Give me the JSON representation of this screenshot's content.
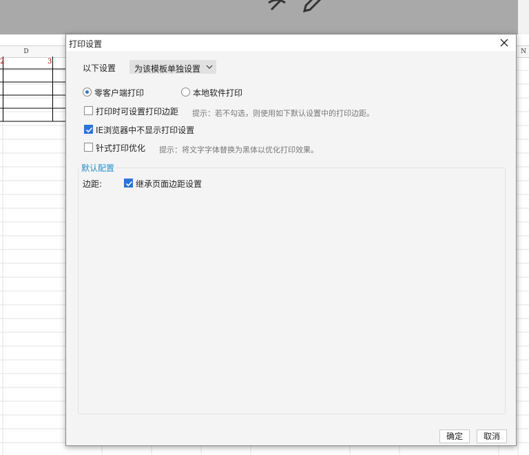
{
  "spreadsheet": {
    "columns": [
      "D",
      "N"
    ],
    "cells": [
      "2",
      "3"
    ]
  },
  "toolbar": {
    "icons": [
      "eye-off-icon",
      "pencil-icon"
    ]
  },
  "dialog": {
    "title": "打印设置",
    "settings_scope": {
      "label": "以下设置",
      "selected": "为该模板单独设置"
    },
    "print_mode": {
      "options": [
        {
          "label": "零客户端打印",
          "selected": true
        },
        {
          "label": "本地软件打印",
          "selected": false
        }
      ]
    },
    "set_margin_on_print": {
      "label": "打印时可设置打印边距",
      "checked": false,
      "hint": "提示：若不勾选，则使用如下默认设置中的打印边距。"
    },
    "ie_hide_settings": {
      "label": "IE浏览器中不显示打印设置",
      "checked": true
    },
    "dot_matrix": {
      "label": "针式打印优化",
      "checked": false,
      "hint": "提示：将文字字体替换为黑体以优化打印效果。"
    },
    "default_config": {
      "legend": "默认配置",
      "margin_label": "边距:",
      "inherit_label": "继承页面边距设置",
      "inherit_checked": true
    },
    "buttons": {
      "ok": "确定",
      "cancel": "取消"
    },
    "colors": {
      "accent": "#2b74d8",
      "legend": "#2a8fc9",
      "hint": "#777777"
    }
  }
}
